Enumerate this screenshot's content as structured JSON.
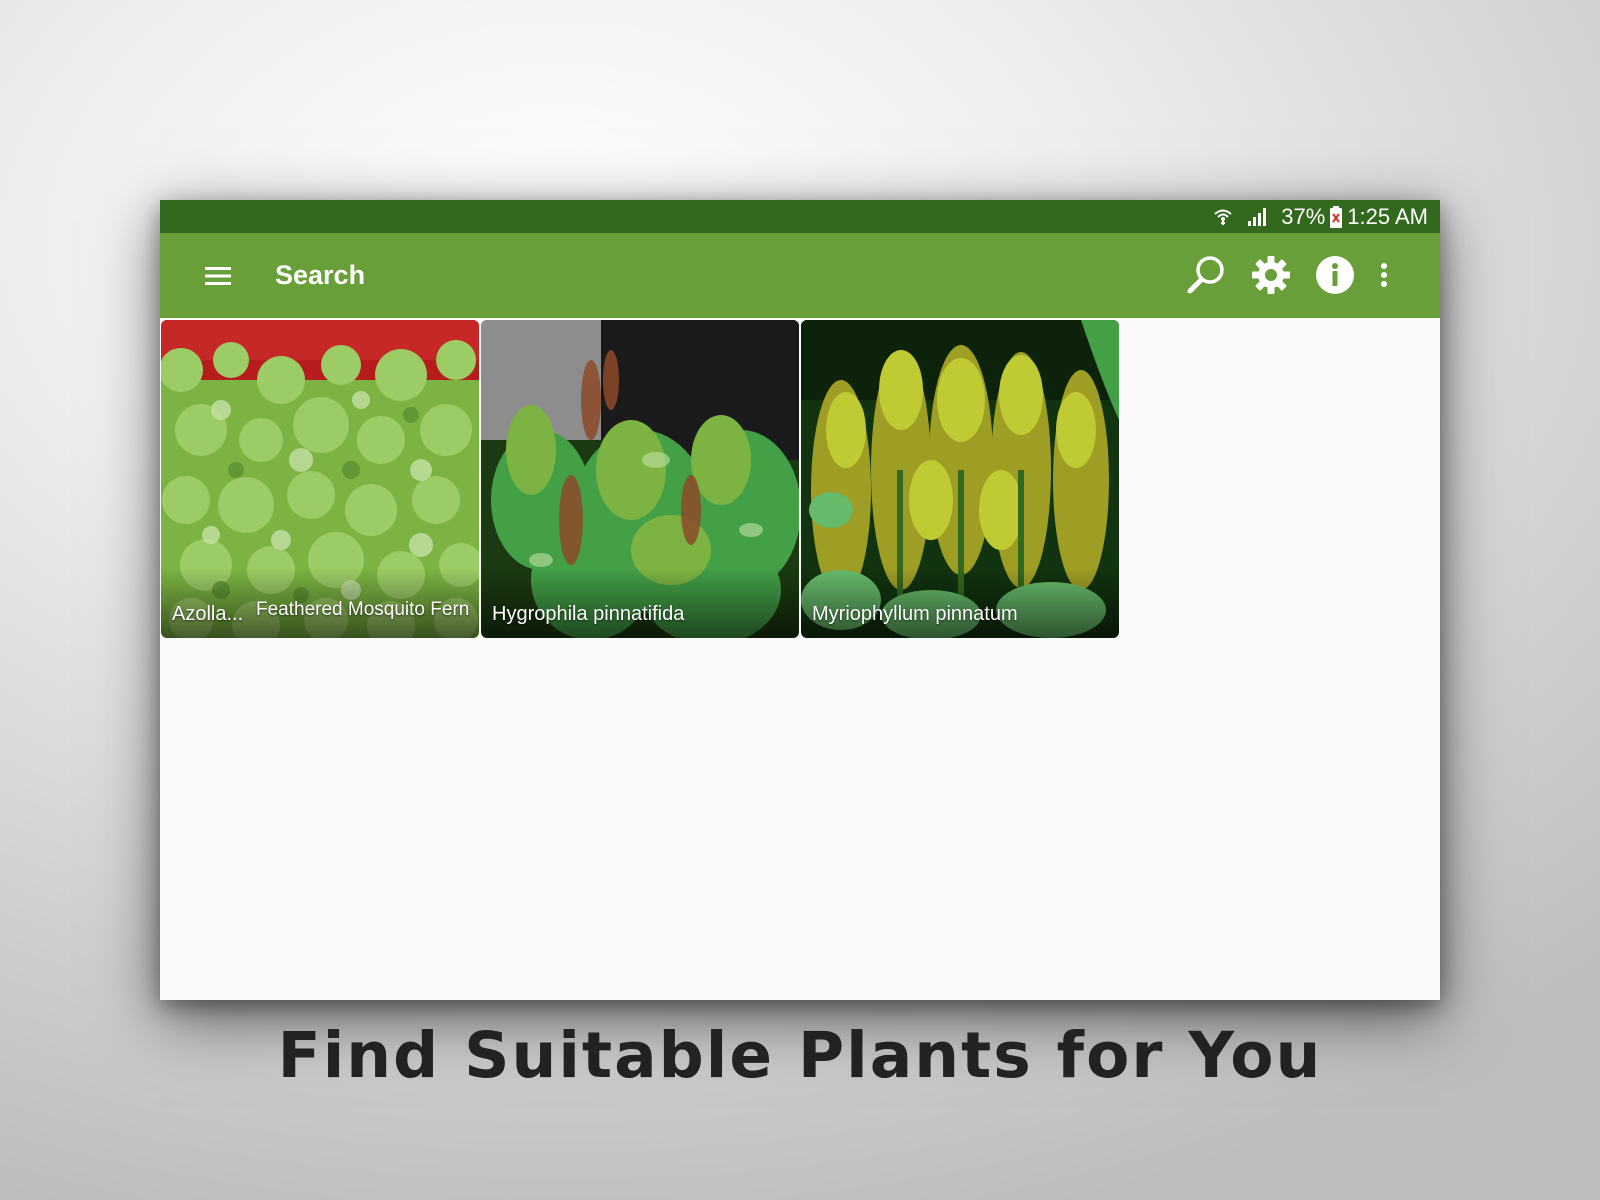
{
  "status_bar": {
    "battery_percent": "37%",
    "time": "1:25 AM",
    "icons": [
      "wifi-icon",
      "signal-icon",
      "battery-icon"
    ]
  },
  "app_bar": {
    "title": "Search",
    "icons": [
      "menu-icon",
      "search-icon",
      "gear-icon",
      "info-icon",
      "more-vert-icon"
    ]
  },
  "plants": [
    {
      "scientific_name": "Azolla...",
      "common_name": "Feathered Mosquito Fern"
    },
    {
      "scientific_name": "Hygrophila pinnatifida"
    },
    {
      "scientific_name": "Myriophyllum pinnatum"
    }
  ],
  "tagline": "Find Suitable Plants for You",
  "colors": {
    "status_bar": "#33691e",
    "app_bar": "#689f38",
    "content_bg": "#fafafa",
    "tagline": "#222222"
  }
}
